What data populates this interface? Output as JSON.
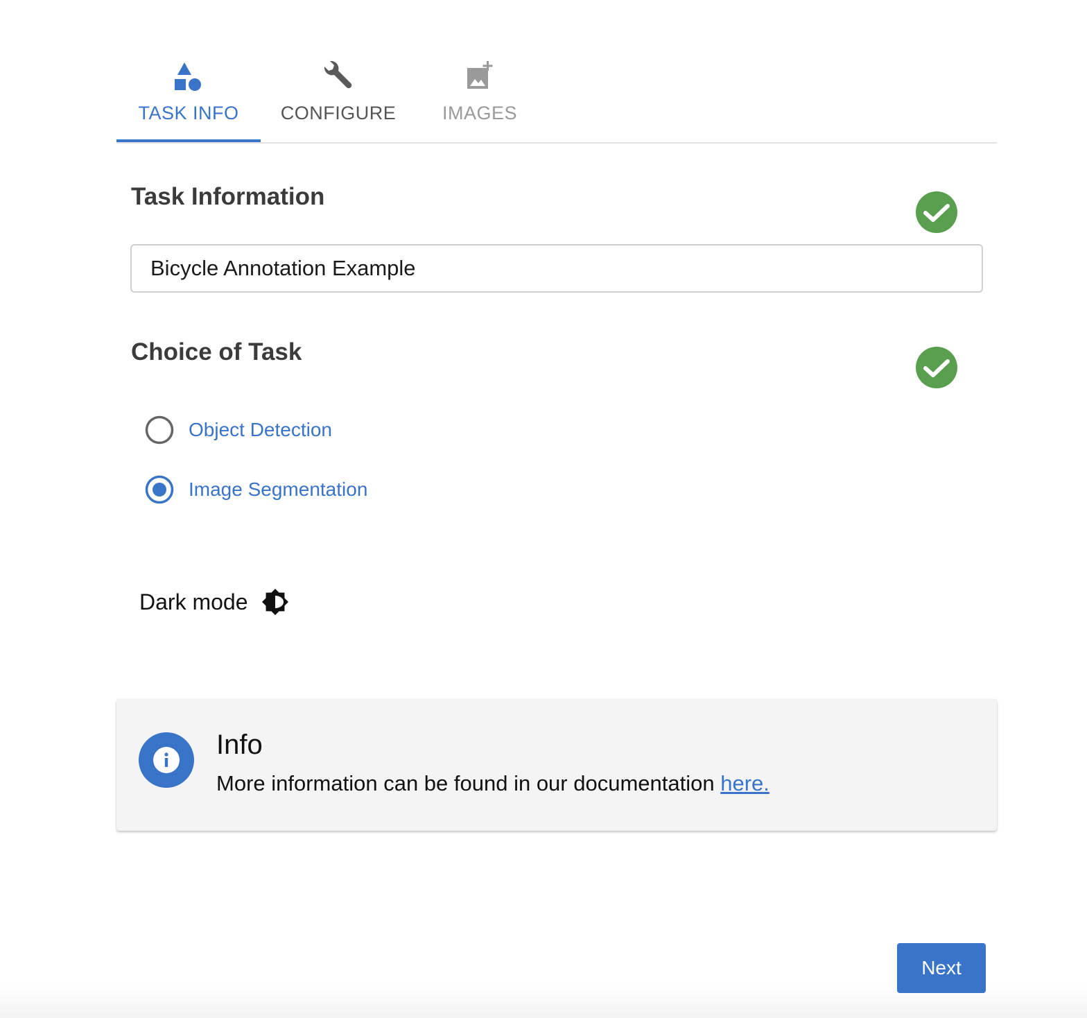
{
  "tabs": [
    {
      "label": "TASK INFO",
      "icon": "shapes-icon",
      "state": "active"
    },
    {
      "label": "CONFIGURE",
      "icon": "wrench-icon",
      "state": "enabled"
    },
    {
      "label": "IMAGES",
      "icon": "add-photo-icon",
      "state": "disabled"
    }
  ],
  "task_info": {
    "title": "Task Information",
    "name_value": "Bicycle Annotation Example",
    "status_icon": "check-circle-icon"
  },
  "choice_of_task": {
    "title": "Choice of Task",
    "status_icon": "check-circle-icon",
    "options": [
      {
        "label": "Object Detection",
        "selected": false
      },
      {
        "label": "Image Segmentation",
        "selected": true
      }
    ]
  },
  "dark_mode": {
    "label": "Dark mode",
    "icon": "brightness-icon"
  },
  "info": {
    "title": "Info",
    "text": "More information can be found in our documentation ",
    "link_text": "here.",
    "icon": "info-icon"
  },
  "footer": {
    "next_label": "Next"
  },
  "colors": {
    "primary": "#3a74c9",
    "success": "#5a9e4f",
    "info_card_bg": "#f4f4f4"
  }
}
